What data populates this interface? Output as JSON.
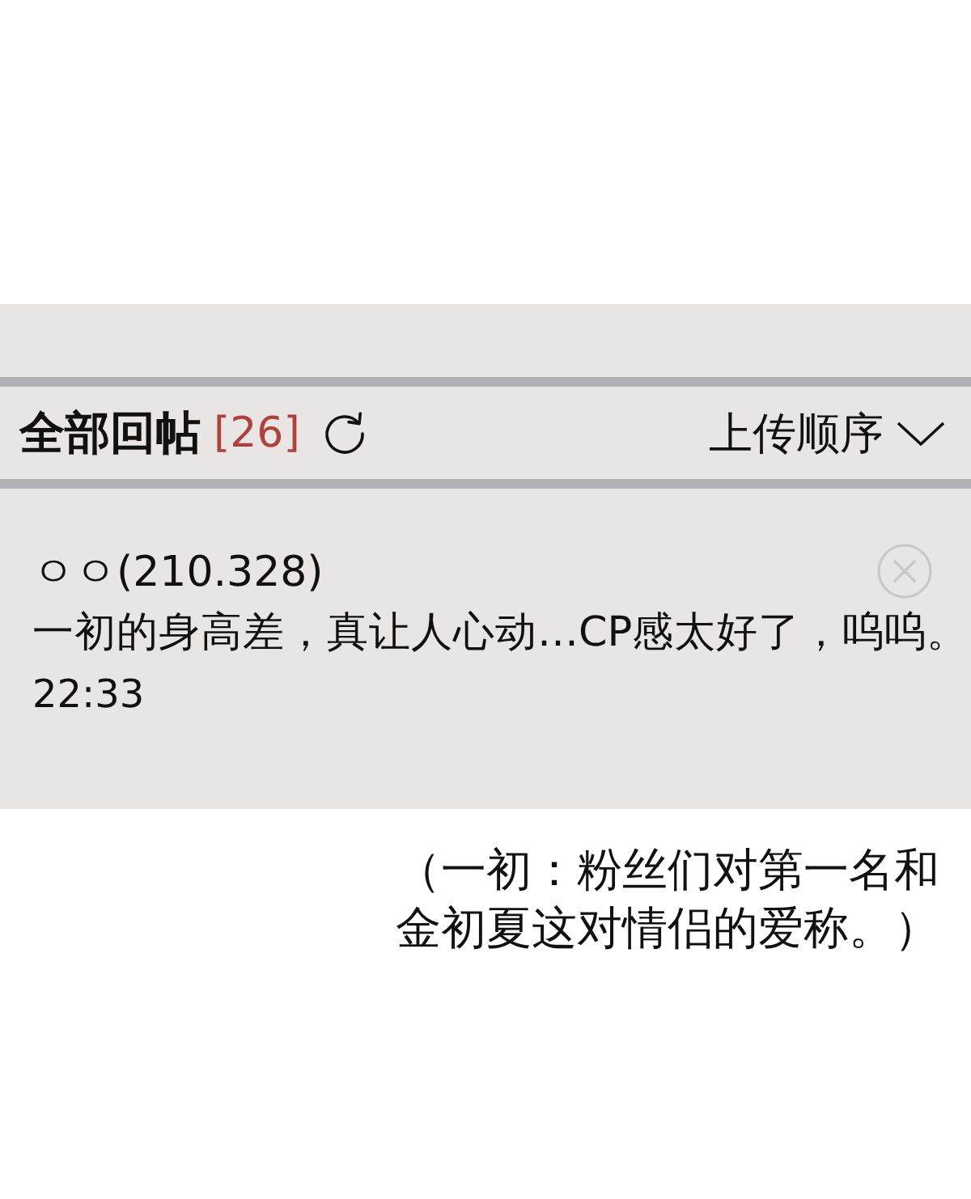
{
  "thread_header": {
    "title": "全部回帖",
    "count": "[26]",
    "sort": "上传顺序"
  },
  "comments": [
    {
      "author": "ㅇㅇ(210.328)",
      "text": "一初的身高差，真让人心动…CP感太好了，呜呜。",
      "time": "22:33"
    }
  ],
  "caption": "（一初：粉丝们对第一名和金初夏这对情侣的爱称。）"
}
